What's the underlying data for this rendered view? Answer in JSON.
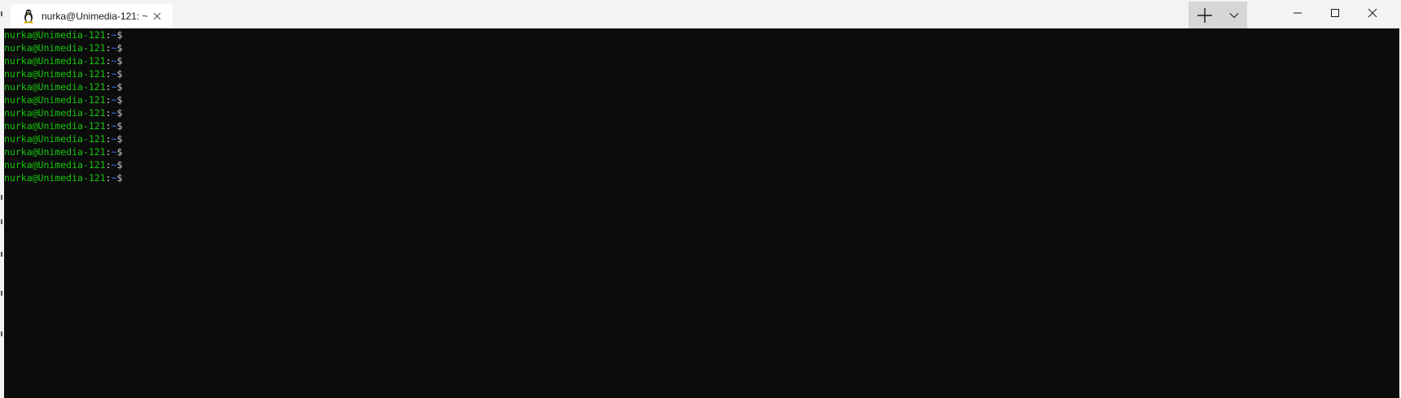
{
  "tab": {
    "title": "nurka@Unimedia-121: ~",
    "icon": "linux-penguin-icon"
  },
  "titlebar": {
    "new_tab_icon": "plus-icon",
    "dropdown_icon": "chevron-down-icon"
  },
  "window_controls": [
    "minimize-icon",
    "maximize-icon",
    "close-icon"
  ],
  "terminal": {
    "prompt_user_host": "nurka@Unimedia-121",
    "prompt_sep": ":",
    "prompt_path": "~",
    "prompt_symbol": "$",
    "lines": [
      {
        "user_host": "nurka@Unimedia-121",
        "sep": ":",
        "path": "~",
        "symbol": "$"
      },
      {
        "user_host": "nurka@Unimedia-121",
        "sep": ":",
        "path": "~",
        "symbol": "$"
      },
      {
        "user_host": "nurka@Unimedia-121",
        "sep": ":",
        "path": "~",
        "symbol": "$"
      },
      {
        "user_host": "nurka@Unimedia-121",
        "sep": ":",
        "path": "~",
        "symbol": "$"
      },
      {
        "user_host": "nurka@Unimedia-121",
        "sep": ":",
        "path": "~",
        "symbol": "$"
      },
      {
        "user_host": "nurka@Unimedia-121",
        "sep": ":",
        "path": "~",
        "symbol": "$"
      },
      {
        "user_host": "nurka@Unimedia-121",
        "sep": ":",
        "path": "~",
        "symbol": "$"
      },
      {
        "user_host": "nurka@Unimedia-121",
        "sep": ":",
        "path": "~",
        "symbol": "$"
      },
      {
        "user_host": "nurka@Unimedia-121",
        "sep": ":",
        "path": "~",
        "symbol": "$"
      },
      {
        "user_host": "nurka@Unimedia-121",
        "sep": ":",
        "path": "~",
        "symbol": "$"
      },
      {
        "user_host": "nurka@Unimedia-121",
        "sep": ":",
        "path": "~",
        "symbol": "$"
      },
      {
        "user_host": "nurka@Unimedia-121",
        "sep": ":",
        "path": "~",
        "symbol": "$"
      }
    ]
  },
  "colors": {
    "terminal_bg": "#0c0c0c",
    "prompt_user": "#16c60c",
    "prompt_path": "#3b78ff",
    "prompt_text": "#cccccc",
    "titlebar_bg": "#f3f3f3"
  }
}
